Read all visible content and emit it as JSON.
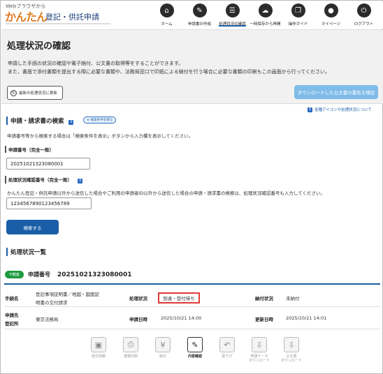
{
  "header": {
    "logo_small": "Webブラウザから",
    "logo_main": "かんたん",
    "logo_sub": "登記・供託申請",
    "nav": [
      {
        "label": "ホーム",
        "icon": "home-icon",
        "glyph": "⌂"
      },
      {
        "label": "申請書の作成",
        "icon": "pen-icon",
        "glyph": "✎"
      },
      {
        "label": "処理状況の確認",
        "icon": "list-icon",
        "glyph": "☰"
      },
      {
        "label": "一時保存から再開",
        "icon": "cloud-icon",
        "glyph": "☁"
      },
      {
        "label": "操作ガイド",
        "icon": "book-icon",
        "glyph": "❐"
      },
      {
        "label": "マイページ",
        "icon": "user-icon",
        "glyph": "●"
      },
      {
        "label": "ログアウト",
        "icon": "logout-icon",
        "glyph": "⏻"
      }
    ]
  },
  "page": {
    "title": "処理状況の確認",
    "intro_line1": "申請した手続の状況の確認や電子納付、公文書の取得等をすることができます。",
    "intro_line2": "また、書面で添付書類を提出する際に必要な書類や、法務局窓口で印紙による納付を行う場合に必要な書類の印刷もこの画面から行ってください。",
    "refresh_button": "最新の処理状況に更新",
    "verify_button": "ダウンロードした公文書の署名を検証",
    "help_link": "各種アイコンや処理状況について"
  },
  "search": {
    "heading": "申請・請求書の検索",
    "toggle": "検索条件を隠る",
    "hint": "申請番号等から検索する場合は「検索条件を表示」ボタンから入力欄を表示してください。",
    "field1_label": "申請番号（完全一致）",
    "field1_value": "20251021323080001",
    "field2_label": "処理状況確認番号（完全一致）",
    "field2_note": "かんたん登記・供託申請以外から送信した場合やご利用の申請者ID以外から送信した場合の申請・請求書の検索は、処理状況確認番号も入力してください。",
    "field2_value": "1234567890123456789",
    "submit": "検索する"
  },
  "results": {
    "heading": "処理状況一覧",
    "badge": "不動産",
    "number_label": "申請番号",
    "number_value": "20251021323080001",
    "proc_name_label": "手続名",
    "proc_name_value1": "登記事項証明書／地図・図面証",
    "proc_name_value2": "明書の交付請求",
    "status_label": "処理状況",
    "status_value": "到達・受付待ち",
    "payment_label": "納付状況",
    "payment_value": "未納付",
    "office_label1": "申請先",
    "office_label2": "登記所",
    "office_value": "東京法務局",
    "applied_label": "申請日時",
    "applied_value": "2025/10/21 14:00",
    "updated_label": "更新日時",
    "updated_value": "2025/10/21 14:01"
  },
  "actions": [
    {
      "label": "受付情報",
      "glyph": "▣",
      "active": false
    },
    {
      "label": "書類印刷",
      "glyph": "⎙",
      "active": false
    },
    {
      "label": "納付",
      "glyph": "¥",
      "active": false
    },
    {
      "label": "内容確認",
      "glyph": "✎",
      "active": true
    },
    {
      "label": "取下げ",
      "glyph": "↶",
      "active": false
    },
    {
      "label": "申請データ\nダウンロード",
      "glyph": "⇩",
      "active": false
    },
    {
      "label": "公文書\nダウンロード",
      "glyph": "⇩",
      "active": false
    }
  ]
}
